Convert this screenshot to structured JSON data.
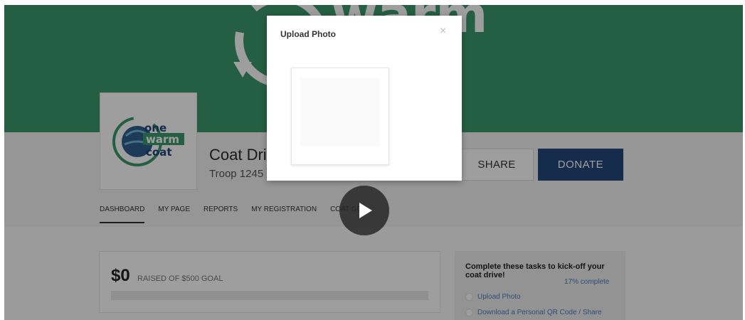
{
  "colors": {
    "banner": "#3a9a6c",
    "donate": "#24477c",
    "link": "#4a7fc1"
  },
  "banner": {
    "logo_text": "warm"
  },
  "logo": {
    "line1": "one",
    "line2": "warm",
    "line3": "coat"
  },
  "drive": {
    "title": "Coat Dri",
    "subtitle": "Troop 1245"
  },
  "actions": {
    "share_label": "SHARE",
    "donate_label": "DONATE"
  },
  "nav": {
    "items": [
      {
        "label": "DASHBOARD"
      },
      {
        "label": "MY PAGE"
      },
      {
        "label": "REPORTS"
      },
      {
        "label": "MY REGISTRATION"
      },
      {
        "label": "COAT GO"
      }
    ]
  },
  "goal": {
    "amount": "$0",
    "text": "RAISED OF $500 GOAL",
    "progress_fraction": 0
  },
  "tasks": {
    "title": "Complete these tasks to kick-off your coat drive!",
    "percent": "17% complete",
    "items": [
      {
        "label": "Upload Photo"
      },
      {
        "label": "Download a Personal QR Code / Share"
      }
    ]
  },
  "modal": {
    "title": "Upload Photo",
    "close_glyph": "×"
  },
  "icons": {
    "play": "play-icon",
    "close": "close-icon"
  }
}
